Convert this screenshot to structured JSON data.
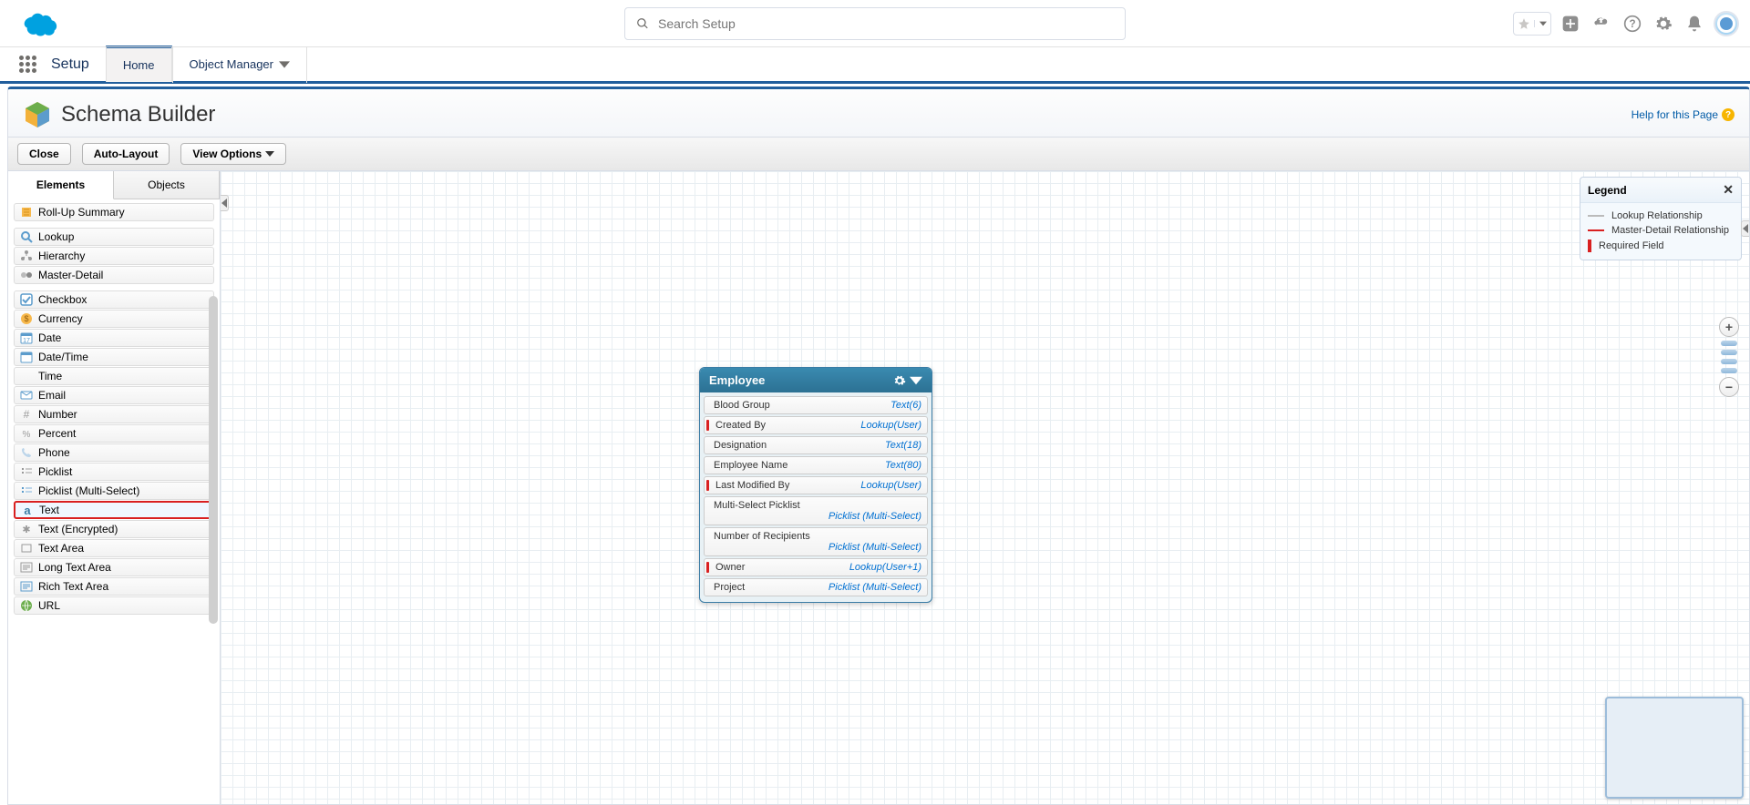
{
  "header": {
    "search_placeholder": "Search Setup"
  },
  "nav": {
    "setup_label": "Setup",
    "tabs": [
      {
        "label": "Home"
      },
      {
        "label": "Object Manager"
      }
    ]
  },
  "page": {
    "title": "Schema Builder",
    "help_label": "Help for this Page"
  },
  "toolbar": {
    "close": "Close",
    "auto_layout": "Auto-Layout",
    "view_options": "View Options"
  },
  "sidebar": {
    "tabs": {
      "elements": "Elements",
      "objects": "Objects"
    },
    "items": [
      "Roll-Up Summary",
      "Lookup",
      "Hierarchy",
      "Master-Detail",
      "Checkbox",
      "Currency",
      "Date",
      "Date/Time",
      "Time",
      "Email",
      "Number",
      "Percent",
      "Phone",
      "Picklist",
      "Picklist (Multi-Select)",
      "Text",
      "Text (Encrypted)",
      "Text Area",
      "Long Text Area",
      "Rich Text Area",
      "URL"
    ],
    "highlighted_index": 15
  },
  "object_card": {
    "title": "Employee",
    "fields": [
      {
        "name": "Blood Group",
        "type": "Text(6)",
        "required": false,
        "wrap": false
      },
      {
        "name": "Created By",
        "type": "Lookup(User)",
        "required": true,
        "wrap": false
      },
      {
        "name": "Designation",
        "type": "Text(18)",
        "required": false,
        "wrap": false
      },
      {
        "name": "Employee Name",
        "type": "Text(80)",
        "required": false,
        "wrap": false
      },
      {
        "name": "Last Modified By",
        "type": "Lookup(User)",
        "required": true,
        "wrap": false
      },
      {
        "name": "Multi-Select Picklist",
        "type": "Picklist (Multi-Select)",
        "required": false,
        "wrap": true
      },
      {
        "name": "Number of Recipients",
        "type": "Picklist (Multi-Select)",
        "required": false,
        "wrap": true
      },
      {
        "name": "Owner",
        "type": "Lookup(User+1)",
        "required": true,
        "wrap": false
      },
      {
        "name": "Project",
        "type": "Picklist (Multi-Select)",
        "required": false,
        "wrap": false
      }
    ]
  },
  "legend": {
    "title": "Legend",
    "lookup": "Lookup Relationship",
    "master": "Master-Detail Relationship",
    "required": "Required Field"
  }
}
